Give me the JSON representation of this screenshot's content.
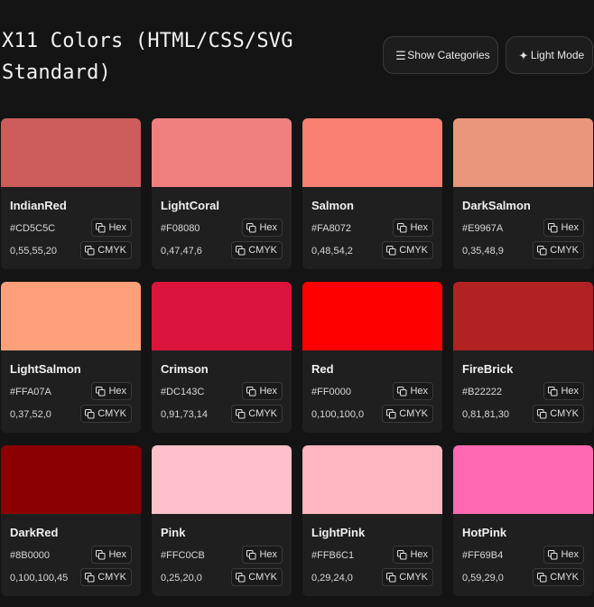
{
  "header": {
    "title": "X11 Colors (HTML/CSS/SVG Standard)",
    "categories_button": {
      "icon": "menu-icon",
      "label": "Show Categories"
    },
    "mode_button": {
      "icon": "sparkle-icon",
      "label": "Light Mode"
    }
  },
  "copy_labels": {
    "hex": "Hex",
    "cmyk": "CMYK",
    "icon": "copy-icon"
  },
  "colors": [
    {
      "name": "IndianRed",
      "hex": "#CD5C5C",
      "cmyk": "0,55,55,20"
    },
    {
      "name": "LightCoral",
      "hex": "#F08080",
      "cmyk": "0,47,47,6"
    },
    {
      "name": "Salmon",
      "hex": "#FA8072",
      "cmyk": "0,48,54,2"
    },
    {
      "name": "DarkSalmon",
      "hex": "#E9967A",
      "cmyk": "0,35,48,9"
    },
    {
      "name": "LightSalmon",
      "hex": "#FFA07A",
      "cmyk": "0,37,52,0"
    },
    {
      "name": "Crimson",
      "hex": "#DC143C",
      "cmyk": "0,91,73,14"
    },
    {
      "name": "Red",
      "hex": "#FF0000",
      "cmyk": "0,100,100,0"
    },
    {
      "name": "FireBrick",
      "hex": "#B22222",
      "cmyk": "0,81,81,30"
    },
    {
      "name": "DarkRed",
      "hex": "#8B0000",
      "cmyk": "0,100,100,45"
    },
    {
      "name": "Pink",
      "hex": "#FFC0CB",
      "cmyk": "0,25,20,0"
    },
    {
      "name": "LightPink",
      "hex": "#FFB6C1",
      "cmyk": "0,29,24,0"
    },
    {
      "name": "HotPink",
      "hex": "#FF69B4",
      "cmyk": "0,59,29,0"
    }
  ]
}
